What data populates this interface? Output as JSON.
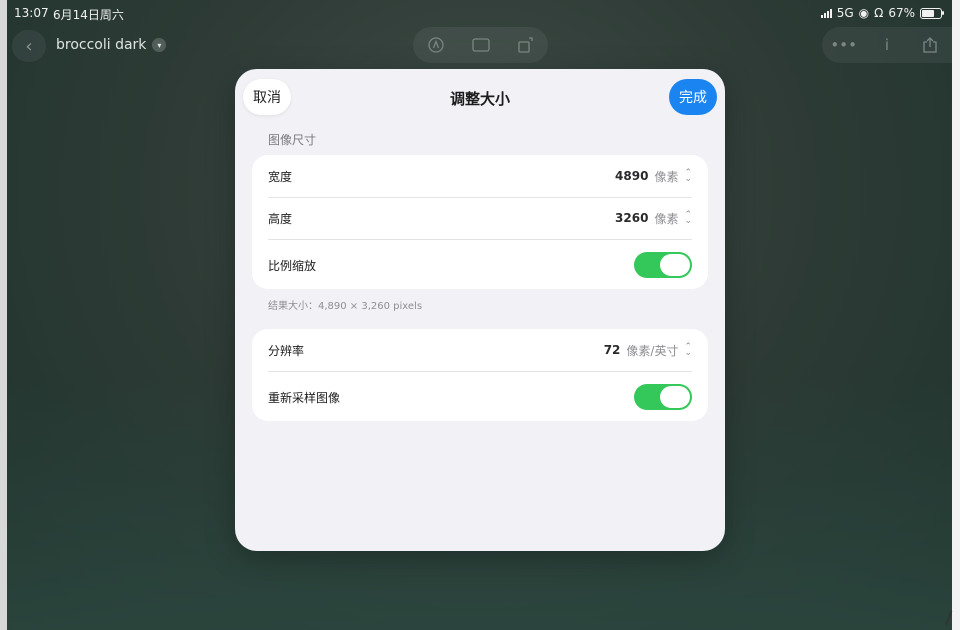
{
  "status_bar": {
    "time": "13:07",
    "date": "6月14日周六",
    "network": "5G",
    "battery": "67%"
  },
  "toolbar": {
    "back_icon": "chevron-left-icon",
    "document_title": "broccoli dark",
    "center_tools": [
      "markup-icon",
      "crop-icon",
      "rotate-icon"
    ],
    "right_tools": [
      "more-icon",
      "info-icon",
      "share-icon"
    ]
  },
  "sheet": {
    "cancel_label": "取消",
    "title": "调整大小",
    "done_label": "完成",
    "section_label": "图像尺寸",
    "width_label": "宽度",
    "width_value": "4890",
    "width_unit": "像素",
    "height_label": "高度",
    "height_value": "3260",
    "height_unit": "像素",
    "scale_label": "比例缩放",
    "scale_on": true,
    "result_text": "结果大小：4,890 × 3,260 pixels",
    "resolution_label": "分辨率",
    "resolution_value": "72",
    "resolution_unit": "像素/英寸",
    "resample_label": "重新采样图像",
    "resample_on": true
  },
  "colors": {
    "accent": "#1a84f0",
    "toggle_on": "#34c759",
    "sheet_bg": "#f1f1f6"
  }
}
